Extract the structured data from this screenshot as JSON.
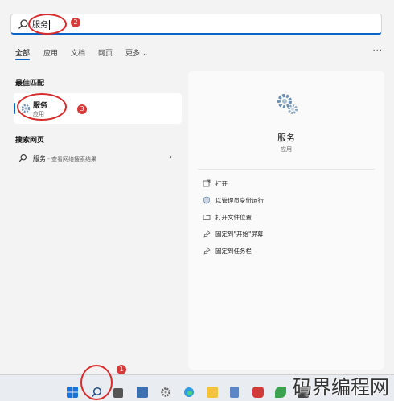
{
  "search": {
    "query": "服务"
  },
  "annotations": {
    "badge_search": "2",
    "badge_result": "3",
    "badge_taskbar": "1"
  },
  "tabs": [
    {
      "label": "全部",
      "active": true
    },
    {
      "label": "应用"
    },
    {
      "label": "文档"
    },
    {
      "label": "网页"
    },
    {
      "label": "更多 ⌄"
    }
  ],
  "more_menu": "···",
  "best_match": {
    "title": "最佳匹配",
    "name": "服务",
    "kind": "应用"
  },
  "web_search": {
    "title": "搜索网页",
    "term": "服务",
    "suffix": " - 查看网络搜索结果",
    "chevron": "›"
  },
  "detail": {
    "name": "服务",
    "kind": "应用",
    "actions": [
      {
        "label": "打开",
        "icon": "open-icon"
      },
      {
        "label": "以管理员身份运行",
        "icon": "shield-icon"
      },
      {
        "label": "打开文件位置",
        "icon": "folder-icon"
      },
      {
        "label": "固定到\"开始\"屏幕",
        "icon": "pin-icon"
      },
      {
        "label": "固定到任务栏",
        "icon": "pin-icon"
      }
    ]
  },
  "taskbar": {
    "icons": [
      "start-icon",
      "search-icon",
      "task-view-icon",
      "store-icon",
      "settings-icon",
      "edge-icon",
      "explorer-icon",
      "notepad-icon",
      "netease-music-icon",
      "app-icon",
      "app-icon"
    ]
  },
  "watermark": "码界编程网",
  "colors": {
    "accent": "#0a64c8",
    "annotation": "#d92b2b"
  }
}
